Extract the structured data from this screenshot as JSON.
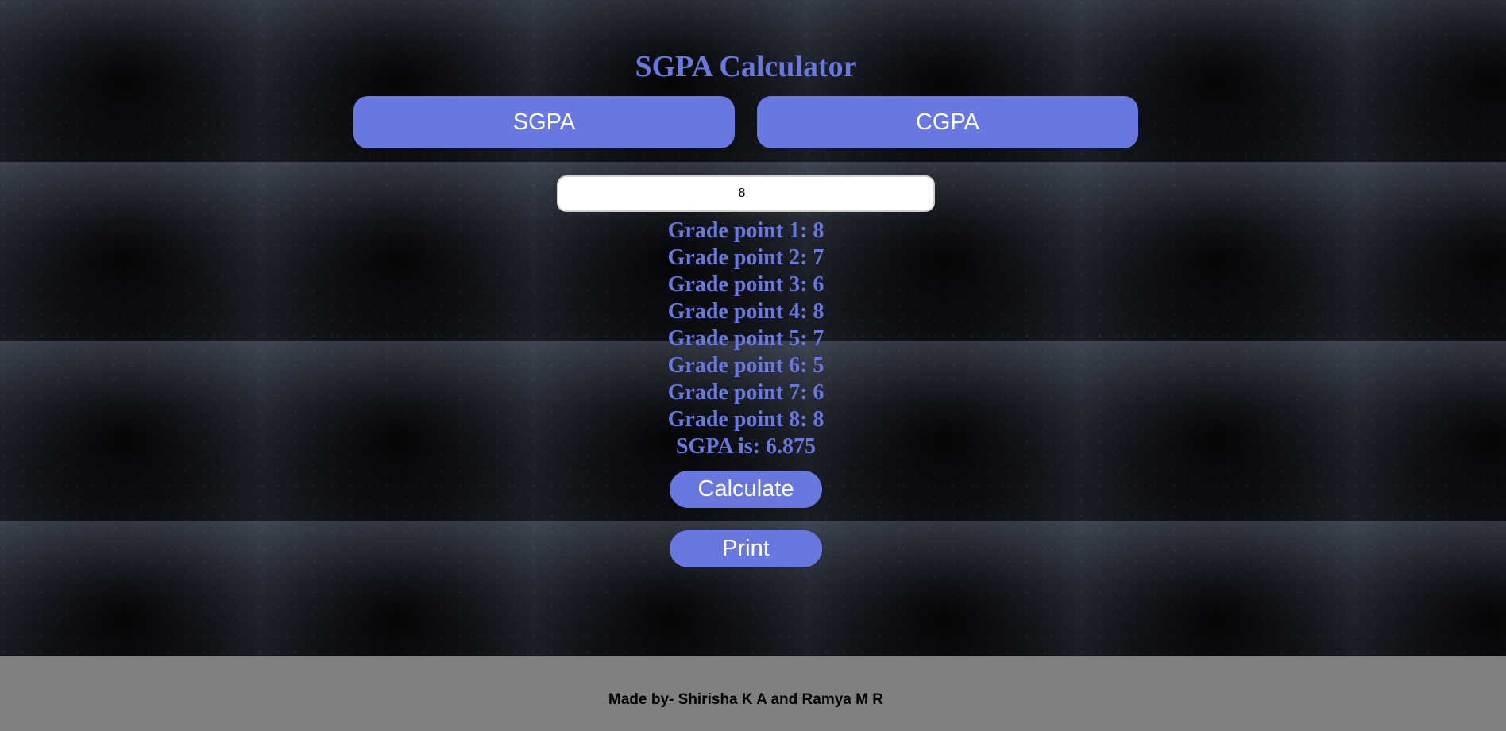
{
  "page": {
    "title": "SGPA Calculator"
  },
  "tabs": {
    "sgpa_label": "SGPA",
    "cgpa_label": "CGPA"
  },
  "subject_count_input": {
    "value": "8"
  },
  "grade_points": [
    "Grade point 1: 8",
    "Grade point 2: 7",
    "Grade point 3: 6",
    "Grade point 4: 8",
    "Grade point 5: 7",
    "Grade point 6: 5",
    "Grade point 7: 6",
    "Grade point 8: 8"
  ],
  "result": {
    "sgpa_text": "SGPA is: 6.875"
  },
  "actions": {
    "calculate_label": "Calculate",
    "print_label": "Print"
  },
  "footer": {
    "credit": "Made by- Shirisha K A and Ramya M R"
  },
  "colors": {
    "accent": "#6878e0",
    "footer_bg": "#808080",
    "button_text": "#ffffff"
  }
}
